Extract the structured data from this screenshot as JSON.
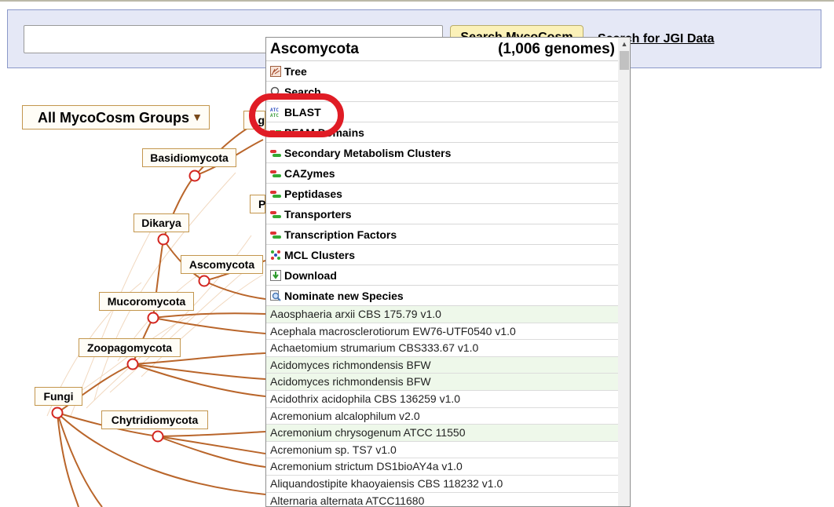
{
  "search": {
    "value": "",
    "button_label": "Search MycoCosm",
    "jgi_link_label": "Search for JGI Data"
  },
  "groups_select": {
    "label": "All MycoCosm Groups",
    "arrow": "▼"
  },
  "tree_labels": {
    "basidiomycota": "Basidiomycota",
    "dikarya": "Dikarya",
    "ascomycota": "Ascomycota",
    "mucoromycota": "Mucoromycota",
    "zoopagomycota": "Zoopagomycota",
    "fungi": "Fungi",
    "chytridiomycota": "Chytridiomycota",
    "partial_g": "g",
    "partial_p": "P"
  },
  "menu": {
    "title": "Ascomycota",
    "count": "(1,006 genomes)",
    "items": [
      {
        "label": "Tree",
        "icon": "tree-icon"
      },
      {
        "label": "Search",
        "icon": "search-icon"
      },
      {
        "label": "BLAST",
        "icon": "dna-icon"
      },
      {
        "label": "PFAM Domains",
        "icon": "domains-icon"
      },
      {
        "label": "Secondary Metabolism Clusters",
        "icon": "bars-icon"
      },
      {
        "label": "CAZymes",
        "icon": "bars-icon"
      },
      {
        "label": "Peptidases",
        "icon": "bars-icon"
      },
      {
        "label": "Transporters",
        "icon": "bars-icon"
      },
      {
        "label": "Transcription Factors",
        "icon": "bars-icon"
      },
      {
        "label": "MCL Clusters",
        "icon": "clusters-icon"
      },
      {
        "label": "Download",
        "icon": "download-icon"
      },
      {
        "label": "Nominate new Species",
        "icon": "zoom-icon"
      }
    ],
    "species": [
      {
        "name": "Aaosphaeria arxii CBS 175.79 v1.0",
        "highlight": true
      },
      {
        "name": "Acephala macrosclerotiorum EW76-UTF0540 v1.0",
        "highlight": false
      },
      {
        "name": "Achaetomium strumarium CBS333.67 v1.0",
        "highlight": false
      },
      {
        "name": "Acidomyces richmondensis BFW",
        "highlight": true
      },
      {
        "name": "Acidomyces richmondensis BFW",
        "highlight": true
      },
      {
        "name": "Acidothrix acidophila CBS 136259 v1.0",
        "highlight": false
      },
      {
        "name": "Acremonium alcalophilum v2.0",
        "highlight": false
      },
      {
        "name": "Acremonium chrysogenum ATCC 11550",
        "highlight": true
      },
      {
        "name": "Acremonium sp. TS7 v1.0",
        "highlight": false
      },
      {
        "name": "Acremonium strictum DS1bioAY4a v1.0",
        "highlight": false
      },
      {
        "name": "Aliquandostipite khaoyaiensis CBS 118232 v1.0",
        "highlight": false
      },
      {
        "name": "Alternaria alternata ATCC11680",
        "highlight": false
      }
    ]
  },
  "colors": {
    "panel_bg": "#e5e8f6",
    "button_bg": "#fbf1b8",
    "branch": "#b9652a",
    "annotation": "#e01c25",
    "species_highlight": "#eef8ea"
  }
}
